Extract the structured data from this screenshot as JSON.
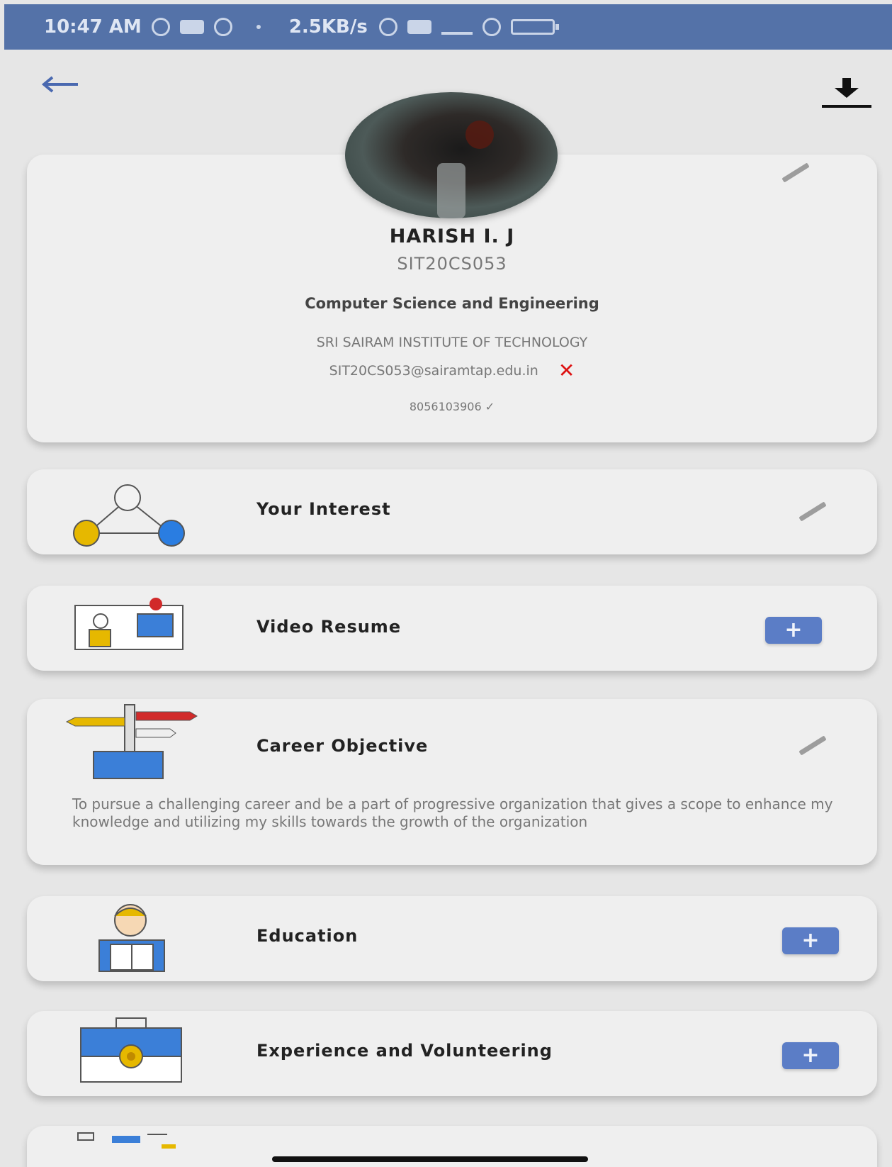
{
  "status_bar": {
    "time": "10:47 AM",
    "network_speed": "2.5KB/s"
  },
  "icons": {
    "back": "back-arrow-icon",
    "download": "download-icon",
    "edit": "pencil-icon",
    "email_status": "x-mark-icon"
  },
  "profile": {
    "name": "HARISH  I. J",
    "student_id": "SIT20CS053",
    "department": "Computer Science and Engineering",
    "institute": "SRI SAIRAM INSTITUTE OF TECHNOLOGY",
    "email": "SIT20CS053@sairamtap.edu.in",
    "email_status_mark": "✕",
    "phone": "8056103906 ✓"
  },
  "sections": {
    "interest": {
      "title": "Your Interest"
    },
    "video_resume": {
      "title": "Video Resume",
      "action": "+"
    },
    "career_objective": {
      "title": "Career Objective",
      "text": "To pursue a challenging career and be a part of progressive organization that gives a scope to enhance my knowledge and utilizing my skills towards the growth of the organization"
    },
    "education": {
      "title": "Education",
      "action": "+"
    },
    "experience": {
      "title": "Experience and Volunteering",
      "action": "+"
    }
  },
  "colors": {
    "status_bar": "#5472a8",
    "accent_button": "#5b7dc6",
    "error": "#dd1111"
  }
}
